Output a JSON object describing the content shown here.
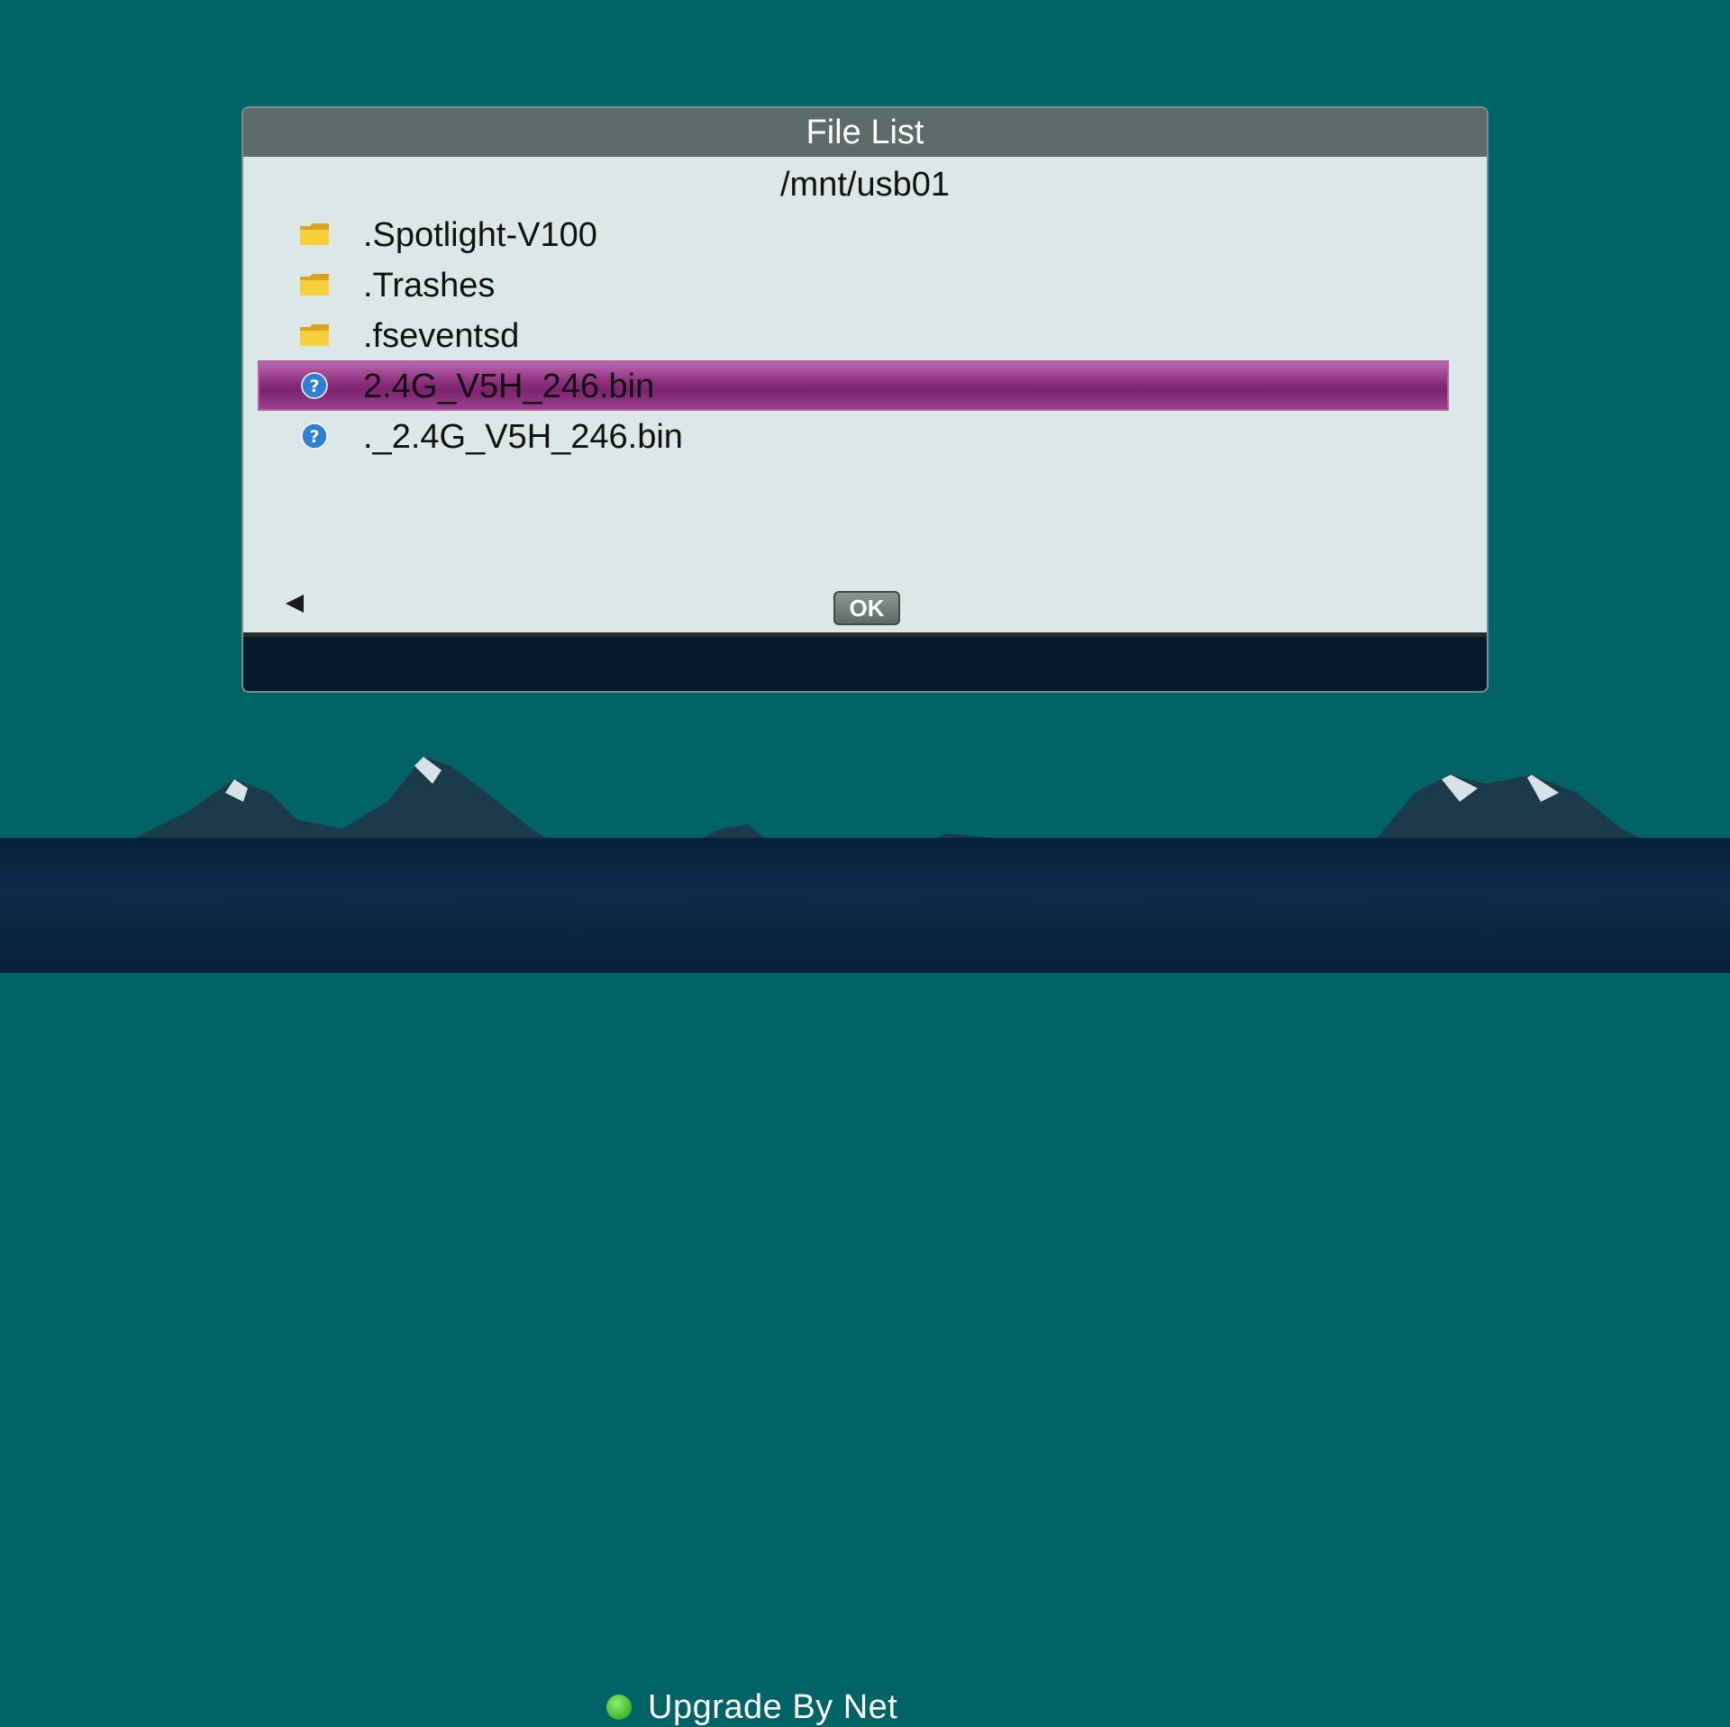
{
  "dialog": {
    "title": "File List",
    "path": "/mnt/usb01",
    "files": [
      {
        "name": ".Spotlight-V100",
        "icon": "folder-icon",
        "selected": false
      },
      {
        "name": ".Trashes",
        "icon": "folder-icon",
        "selected": false
      },
      {
        "name": ".fseventsd",
        "icon": "folder-icon",
        "selected": false
      },
      {
        "name": "2.4G_V5H_246.bin",
        "icon": "unknown-file-icon",
        "selected": true
      },
      {
        "name": "._2.4G_V5H_246.bin",
        "icon": "unknown-file-icon",
        "selected": false
      }
    ],
    "ok_label": "OK"
  },
  "status": {
    "label": "Upgrade By Net",
    "indicator_color": "#46c72f"
  },
  "colors": {
    "background": "#006365",
    "selection": "#8a2d7c",
    "title_bar": "#5c6a69"
  }
}
